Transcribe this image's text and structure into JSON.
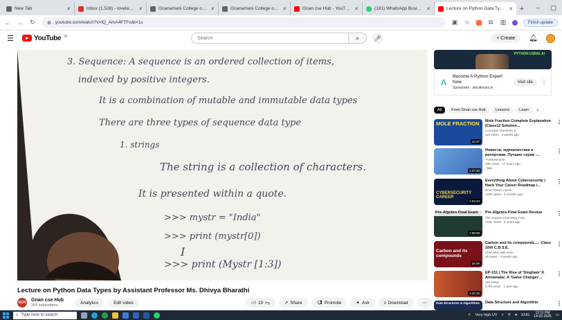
{
  "browser": {
    "tabs": [
      {
        "title": "New Tab",
        "color": "#5f6368",
        "active": false
      },
      {
        "title": "Inbox (1,528) - loveladassinh...",
        "color": "#d93025",
        "active": false
      },
      {
        "title": "Gnanamani College of Technol...",
        "color": "#5f6368",
        "active": false
      },
      {
        "title": "Gnanamani College of Technol...",
        "color": "#5f6368",
        "active": false
      },
      {
        "title": "Gnan cse Hub - YouTube",
        "color": "#ff0000",
        "active": false
      },
      {
        "title": "(181) WhatsApp Business",
        "color": "#25d366",
        "active": false
      },
      {
        "title": "Lecture on Python Data Ty...",
        "color": "#ff0000",
        "active": true
      }
    ],
    "url": "youtube.com/watch?v=lQ_AmA4FTFo&t=1s",
    "update_label": "Finish update"
  },
  "youtube": {
    "logo_text": "YouTube",
    "logo_sup": "IN",
    "search_placeholder": "Search",
    "create_label": "Create"
  },
  "video": {
    "title": "Lecture on Python Data Types by Assistant Professor Ms. Dhivya Bharathi",
    "channel_name": "Gnan cse Hub",
    "channel_avatar_text": "GCH",
    "subscribers": "169 subscribers",
    "analytics_label": "Analytics",
    "edit_label": "Edit video",
    "likes": "19",
    "share_label": "Share",
    "promote_label": "Promote",
    "ask_label": "Ask",
    "download_label": "Download",
    "board_lines": [
      "3. Sequence: A sequence is an ordered collection of items,",
      "indexed by positive integers.",
      "It is a combination of mutable and immutable data types",
      "There are three types of sequence data type",
      "1. strings",
      "The string is a collection of characters.",
      "It is presented within a quote.",
      ">>> mystr = \"India\"",
      ">>> print (mystr[0])",
      "I",
      ">>> print (Mystr [1:3])"
    ]
  },
  "ad": {
    "banner_text": "PYTHON USING AI",
    "title": "Become A Python Expert Now",
    "sponsored": "Sponsored · allcollectes.in",
    "visit_label": "Visit site"
  },
  "chips": [
    "All",
    "From Gnan cse Hub",
    "Lessons",
    "Learn"
  ],
  "recommendations": [
    {
      "thumb_text": "MOLE FRACTION",
      "thumb_color": "#1b4a9a",
      "duration": "10:47",
      "title": "Mole Fraction Complete Explanation |Class12 Solution...",
      "channel": "Concepts Chemistry 5",
      "stats": "110 views · 2 weeks ago",
      "badge": ""
    },
    {
      "thumb_text": "",
      "thumb_color": "#5b88c7",
      "duration": "1:07:30",
      "title": "Новости, журналистика и репортажи. Лучшие серии -...",
      "channel": "TVSmeshariki",
      "stats": "28K views · 17 hours ago",
      "badge": "New"
    },
    {
      "thumb_text": "CYBERSECURITY CAREER",
      "thumb_color": "#0b1a3c",
      "duration": "1:04:23",
      "title": "Everything About Cybersecurity | Hack Your Career Roadmap i...",
      "channel": "Error Makes Clever",
      "stats": "123K views · 6 months ago",
      "badge": ""
    },
    {
      "thumb_text": "Pre-Algebra Final Exam",
      "thumb_color": "#1f3b33",
      "duration": "1:58:08",
      "title": "Pre-Algebra Final Exam Review",
      "channel": "The Organic Chemistry Tutor",
      "stats": "719K views · 6 years ago",
      "badge": ""
    },
    {
      "thumb_text": "Carbon and its compounds",
      "thumb_color": "#7a1219",
      "duration": "28:09",
      "title": "Carbon and its compounds..... Class 10th C.B.S.E.",
      "channel": "Chemistry wali mam",
      "stats": "26 views · 3 weeks ago",
      "badge": ""
    },
    {
      "thumb_text": "",
      "thumb_color": "#b34a2d",
      "duration": "1:42:16",
      "title": "EP-151 | The Rise of 'Singham' K Annamalai: A 'Game Changer'...",
      "channel": "ANI News",
      "stats": "5.7M views · 1 year ago",
      "badge": ""
    },
    {
      "thumb_text": "Data Structures & Algorithms",
      "thumb_color": "#1c2b52",
      "duration": "",
      "title": "Data Structure and Algorithm",
      "channel": "",
      "stats": "",
      "badge": ""
    }
  ],
  "taskbar": {
    "search_placeholder": "Type here to search",
    "weather": "Very high UV",
    "lang": "ENG",
    "time": "12:11 PM",
    "date": "14-02-2025"
  }
}
